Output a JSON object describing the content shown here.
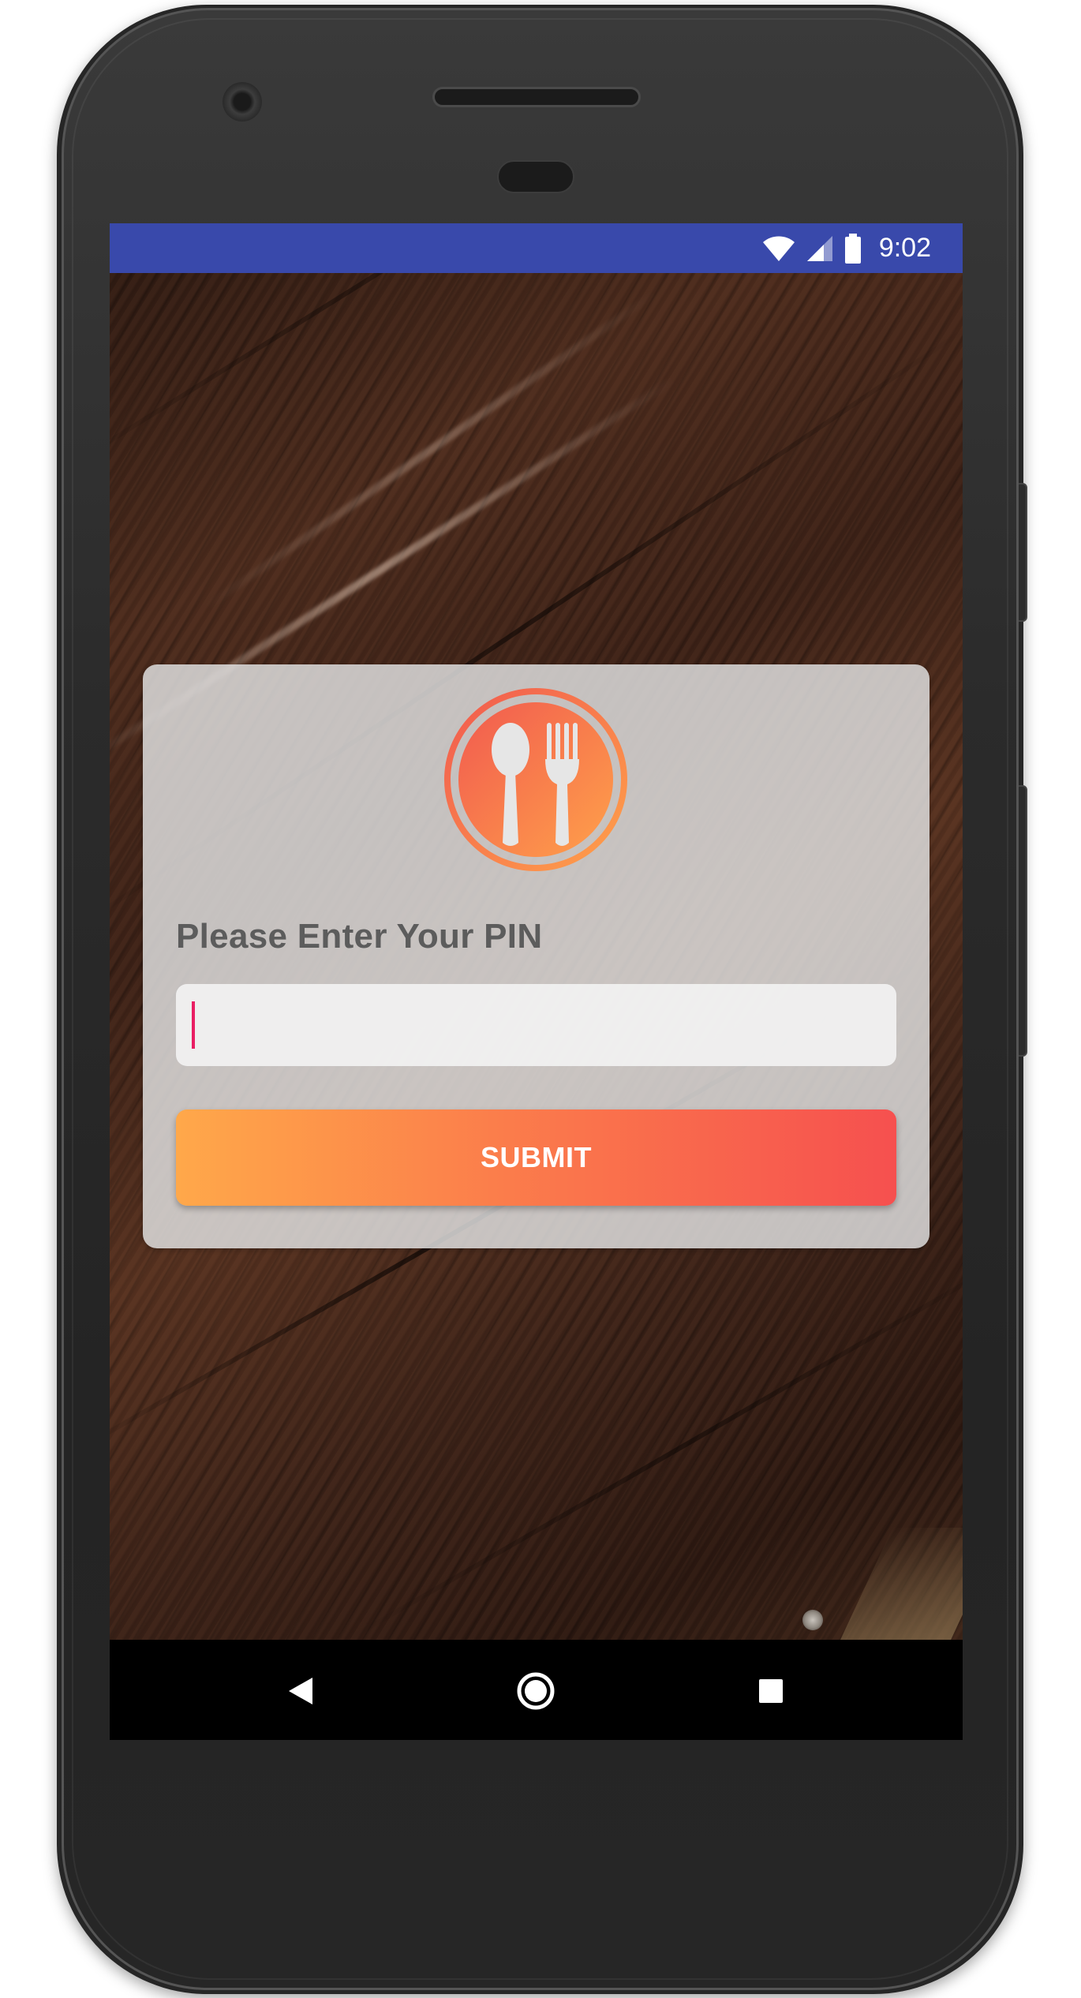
{
  "status_bar": {
    "time": "9:02",
    "color": "#3949ab",
    "icons": [
      "wifi-icon",
      "cell-signal-icon",
      "battery-icon"
    ]
  },
  "login_card": {
    "logo_icon": "spoon-fork-icon",
    "prompt": "Please Enter Your PIN",
    "pin_input": {
      "value": "",
      "placeholder": ""
    },
    "submit_label": "SUBMIT",
    "accent_gradient": [
      "#ffa84a",
      "#f6504f"
    ],
    "cursor_color": "#e91e63"
  },
  "navigation_bar": {
    "buttons": [
      "back-icon",
      "home-icon",
      "recents-icon"
    ]
  }
}
